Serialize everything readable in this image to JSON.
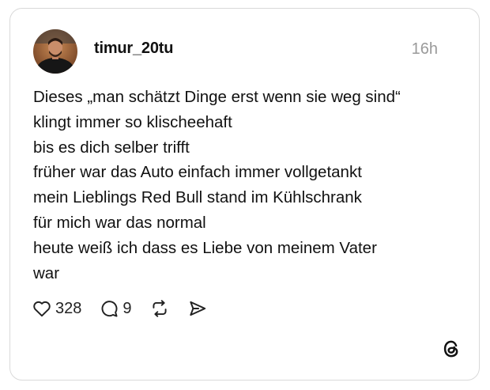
{
  "post": {
    "username": "timur_20tu",
    "time": "16h",
    "lines": [
      "Dieses „man schätzt Dinge erst wenn sie weg sind“",
      "klingt immer so klischeehaft",
      "bis es dich selber trifft",
      "früher war das Auto einfach immer vollgetankt",
      "mein Lieblings Red Bull stand im Kühlschrank",
      "für mich war das normal",
      "heute weiß ich dass es Liebe von meinem Vater",
      "war"
    ],
    "likes": "328",
    "replies": "9"
  },
  "icons": {
    "like": "heart-icon",
    "reply": "comment-icon",
    "repost": "repost-icon",
    "share": "send-icon",
    "brand": "threads-logo-icon"
  },
  "colors": {
    "text": "#111111",
    "muted": "#9a9a9a",
    "border": "#d9d9d9"
  }
}
